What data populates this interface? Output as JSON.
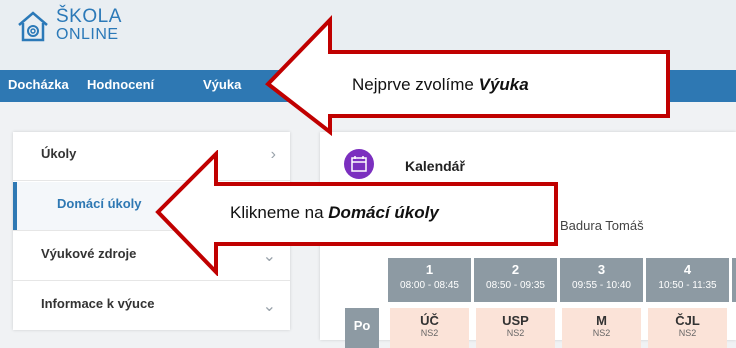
{
  "app": {
    "name_line1": "ŠKOLA",
    "name_line2": "ONLINE"
  },
  "nav": {
    "items": [
      "Docházka",
      "Hodnocení",
      "Výuka"
    ]
  },
  "sidebar": {
    "items": [
      {
        "label": "Úkoly"
      },
      {
        "label": "Domácí úkoly"
      },
      {
        "label": "Výukové zdroje"
      },
      {
        "label": "Informace k výuce"
      }
    ]
  },
  "main": {
    "title": "Kalendář",
    "teacher": "Badura Tomáš",
    "lessons": [
      {
        "num": "1",
        "time": "08:00 - 08:45"
      },
      {
        "num": "2",
        "time": "08:50 - 09:35"
      },
      {
        "num": "3",
        "time": "09:55 - 10:40"
      },
      {
        "num": "4",
        "time": "10:50 - 11:35"
      }
    ],
    "day": "Po",
    "cells": [
      {
        "subject": "ÚČ",
        "room": "NS2"
      },
      {
        "subject": "USP",
        "room": "NS2"
      },
      {
        "subject": "M",
        "room": "NS2"
      },
      {
        "subject": "ČJL",
        "room": "NS2"
      }
    ]
  },
  "annotations": {
    "top_prefix": "Nejprve zvolíme ",
    "top_emph": "Výuka",
    "bottom_prefix": "Klikneme na ",
    "bottom_emph": "Domácí úkoly"
  },
  "colors": {
    "accent": "#2e78b3",
    "arrow": "#c00000",
    "calendar": "#7b2fbf",
    "lesson_cell": "#fbe3d8"
  }
}
